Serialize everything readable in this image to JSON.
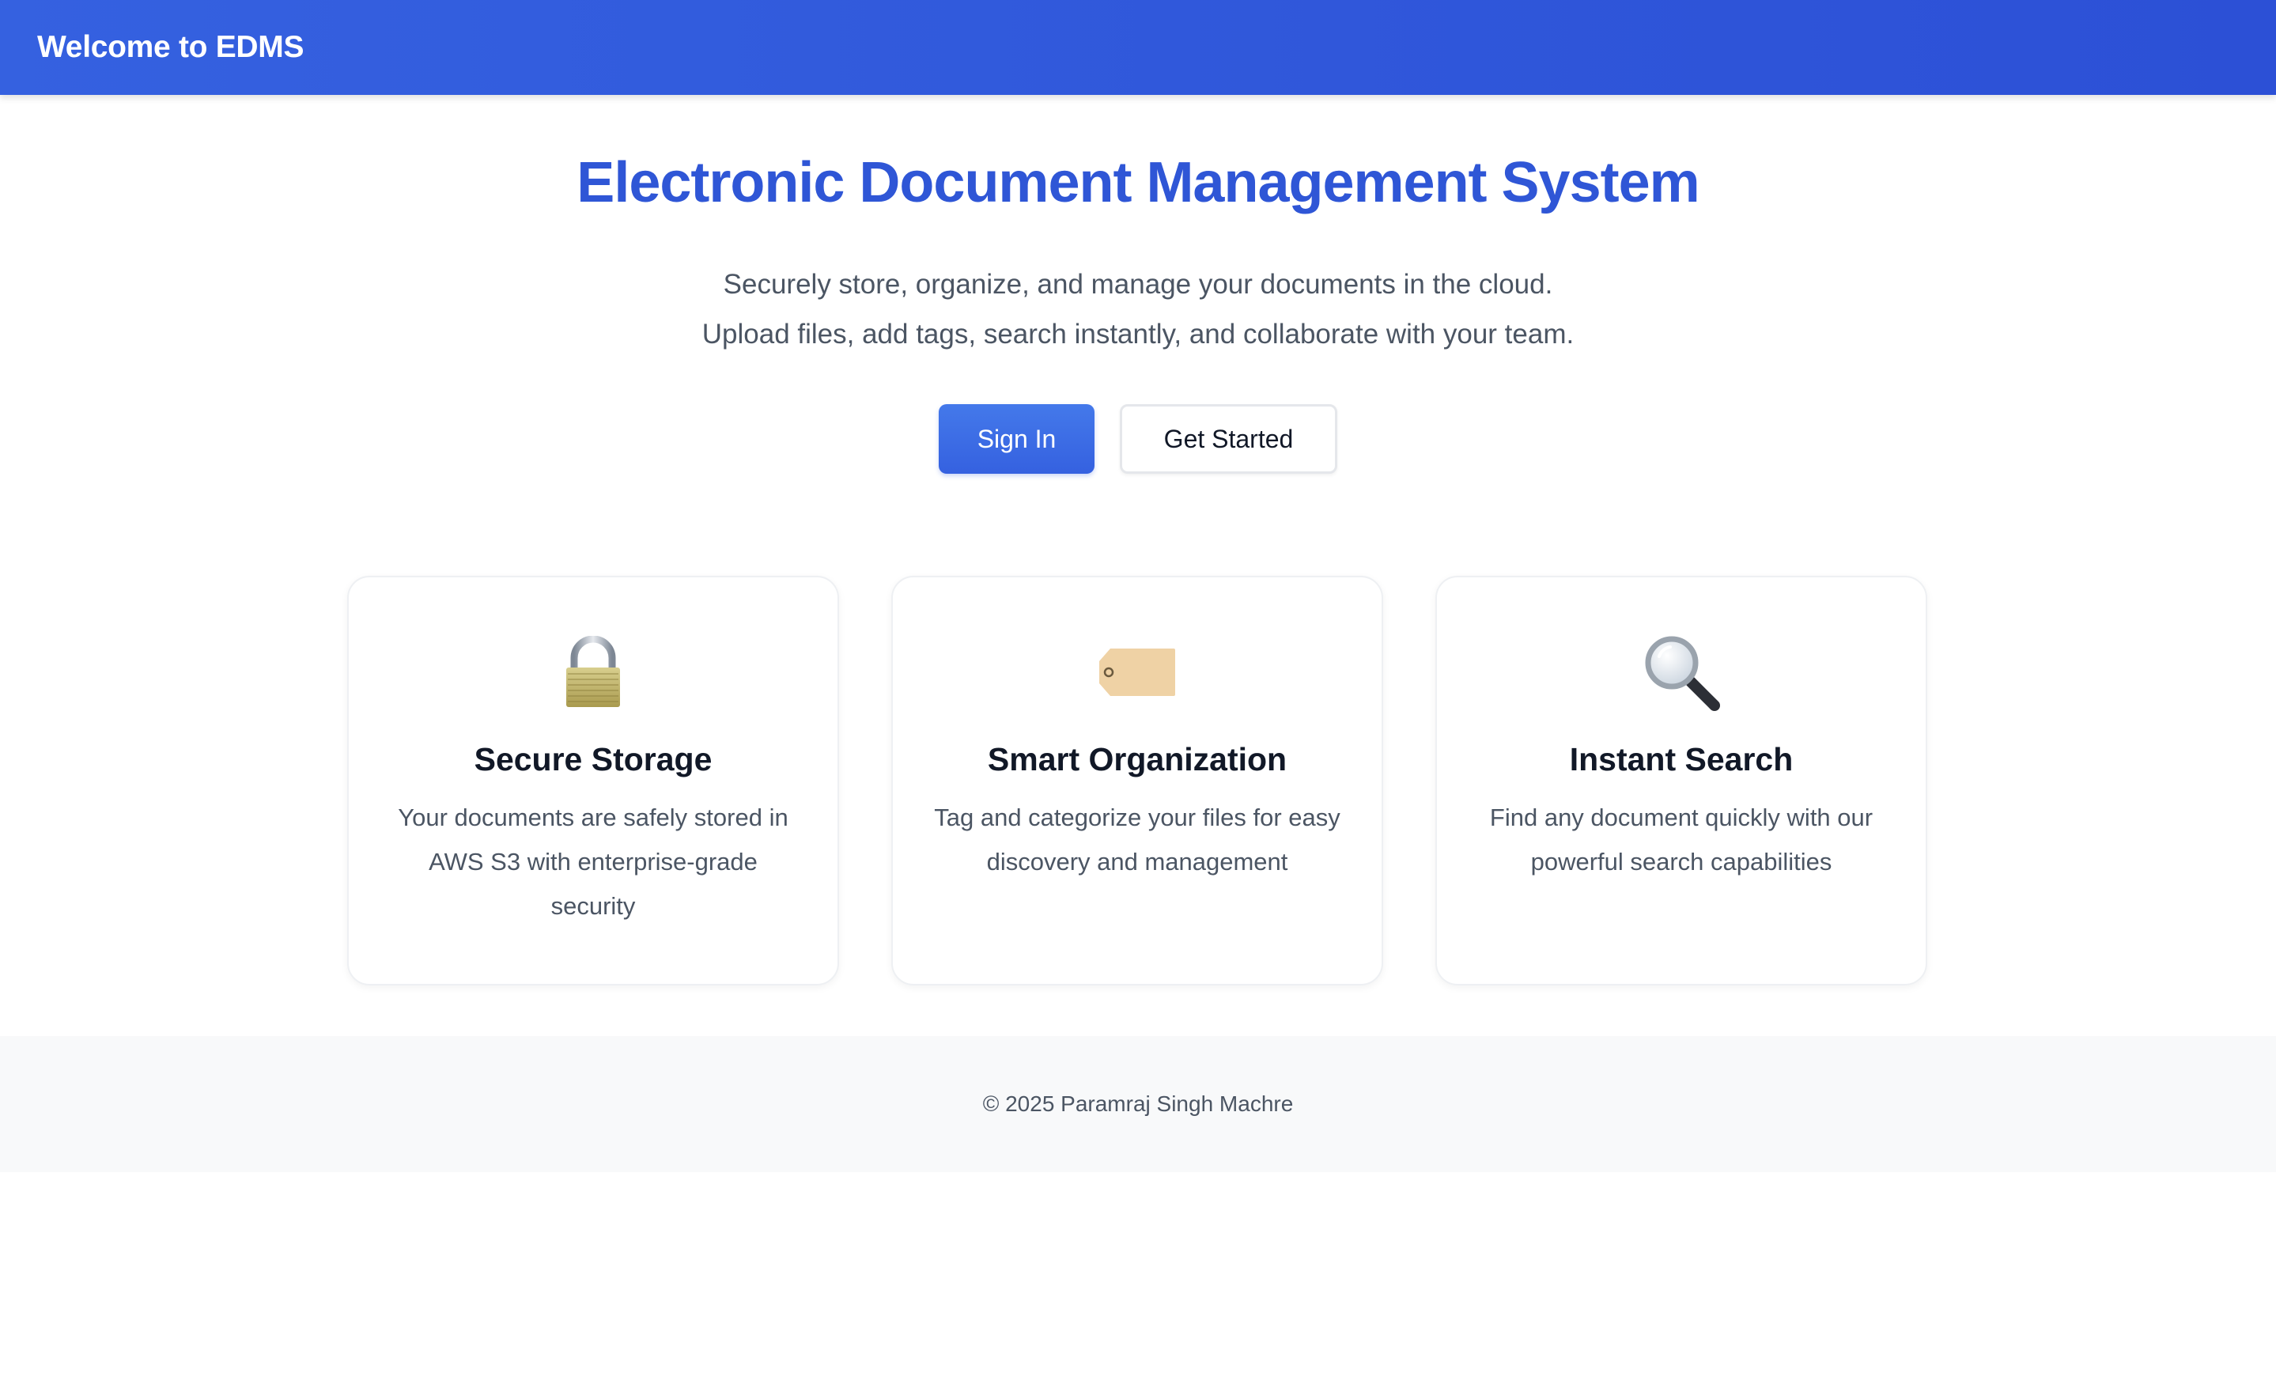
{
  "header": {
    "title": "Welcome to EDMS",
    "background": "#3561e0"
  },
  "hero": {
    "title": "Electronic Document Management System",
    "subtitle_line1": "Securely store, organize, and manage your documents in the cloud.",
    "subtitle_line2": "Upload files, add tags, search instantly, and collaborate with your team.",
    "title_color": "#2f56d6"
  },
  "buttons": {
    "sign_in": "Sign In",
    "get_started": "Get Started",
    "primary_color": "#3561e0"
  },
  "features": [
    {
      "icon": "lock-icon",
      "title": "Secure Storage",
      "description": "Your documents are safely stored in AWS S3 with enterprise-grade security"
    },
    {
      "icon": "tag-icon",
      "title": "Smart Organization",
      "description": "Tag and categorize your files for easy discovery and management"
    },
    {
      "icon": "magnifier-icon",
      "title": "Instant Search",
      "description": "Find any document quickly with our powerful search capabilities"
    }
  ],
  "footer": {
    "text": "© 2025 Paramraj Singh Machre"
  }
}
